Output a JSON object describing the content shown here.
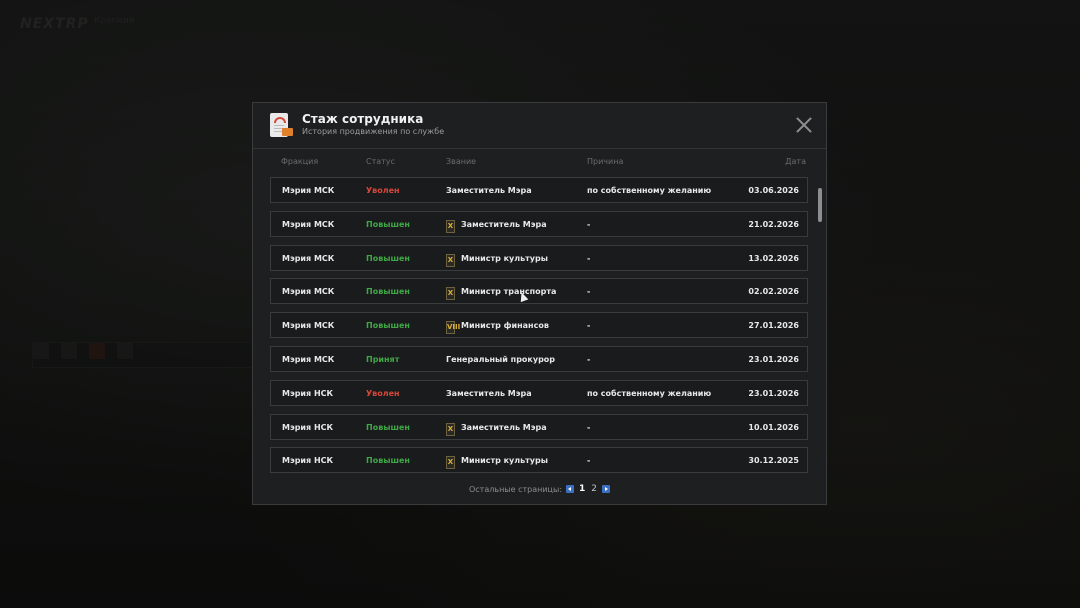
{
  "background": {
    "logo": "NEXTRP",
    "logo_sub": "Крепкий"
  },
  "modal": {
    "title": "Стаж сотрудника",
    "subtitle": "История продвижения по службе",
    "columns": {
      "faction": "Фракция",
      "status": "Статус",
      "rank": "Звание",
      "reason": "Причина",
      "date": "Дата"
    },
    "rows": [
      {
        "faction": "Мэрия МСК",
        "status": "Уволен",
        "status_type": "fired",
        "rank_icon": "",
        "rank": "Заместитель Мэра",
        "reason": "по собственному желанию",
        "date": "03.06.2026"
      },
      {
        "faction": "Мэрия МСК",
        "status": "Повышен",
        "status_type": "promoted",
        "rank_icon": "X",
        "rank": "Заместитель Мэра",
        "reason": "-",
        "date": "21.02.2026"
      },
      {
        "faction": "Мэрия МСК",
        "status": "Повышен",
        "status_type": "promoted",
        "rank_icon": "X",
        "rank": "Министр культуры",
        "reason": "-",
        "date": "13.02.2026"
      },
      {
        "faction": "Мэрия МСК",
        "status": "Повышен",
        "status_type": "promoted",
        "rank_icon": "X",
        "rank": "Министр транспорта",
        "reason": "-",
        "date": "02.02.2026"
      },
      {
        "faction": "Мэрия МСК",
        "status": "Повышен",
        "status_type": "promoted",
        "rank_icon": "VIII",
        "rank": "Министр финансов",
        "reason": "-",
        "date": "27.01.2026"
      },
      {
        "faction": "Мэрия МСК",
        "status": "Принят",
        "status_type": "hired",
        "rank_icon": "",
        "rank": "Генеральный прокурор",
        "reason": "-",
        "date": "23.01.2026"
      },
      {
        "faction": "Мэрия НСК",
        "status": "Уволен",
        "status_type": "fired",
        "rank_icon": "",
        "rank": "Заместитель Мэра",
        "reason": "по собственному желанию",
        "date": "23.01.2026"
      },
      {
        "faction": "Мэрия НСК",
        "status": "Повышен",
        "status_type": "promoted",
        "rank_icon": "X",
        "rank": "Заместитель Мэра",
        "reason": "-",
        "date": "10.01.2026"
      },
      {
        "faction": "Мэрия НСК",
        "status": "Повышен",
        "status_type": "promoted",
        "rank_icon": "X",
        "rank": "Министр культуры",
        "reason": "-",
        "date": "30.12.2025"
      }
    ],
    "pagination": {
      "label": "Остальные страницы:",
      "pages": [
        "1",
        "2"
      ],
      "current": "1"
    }
  },
  "colors": {
    "fired": "#d8473a",
    "promoted": "#3fa845",
    "accent": "#3a6fc2"
  }
}
